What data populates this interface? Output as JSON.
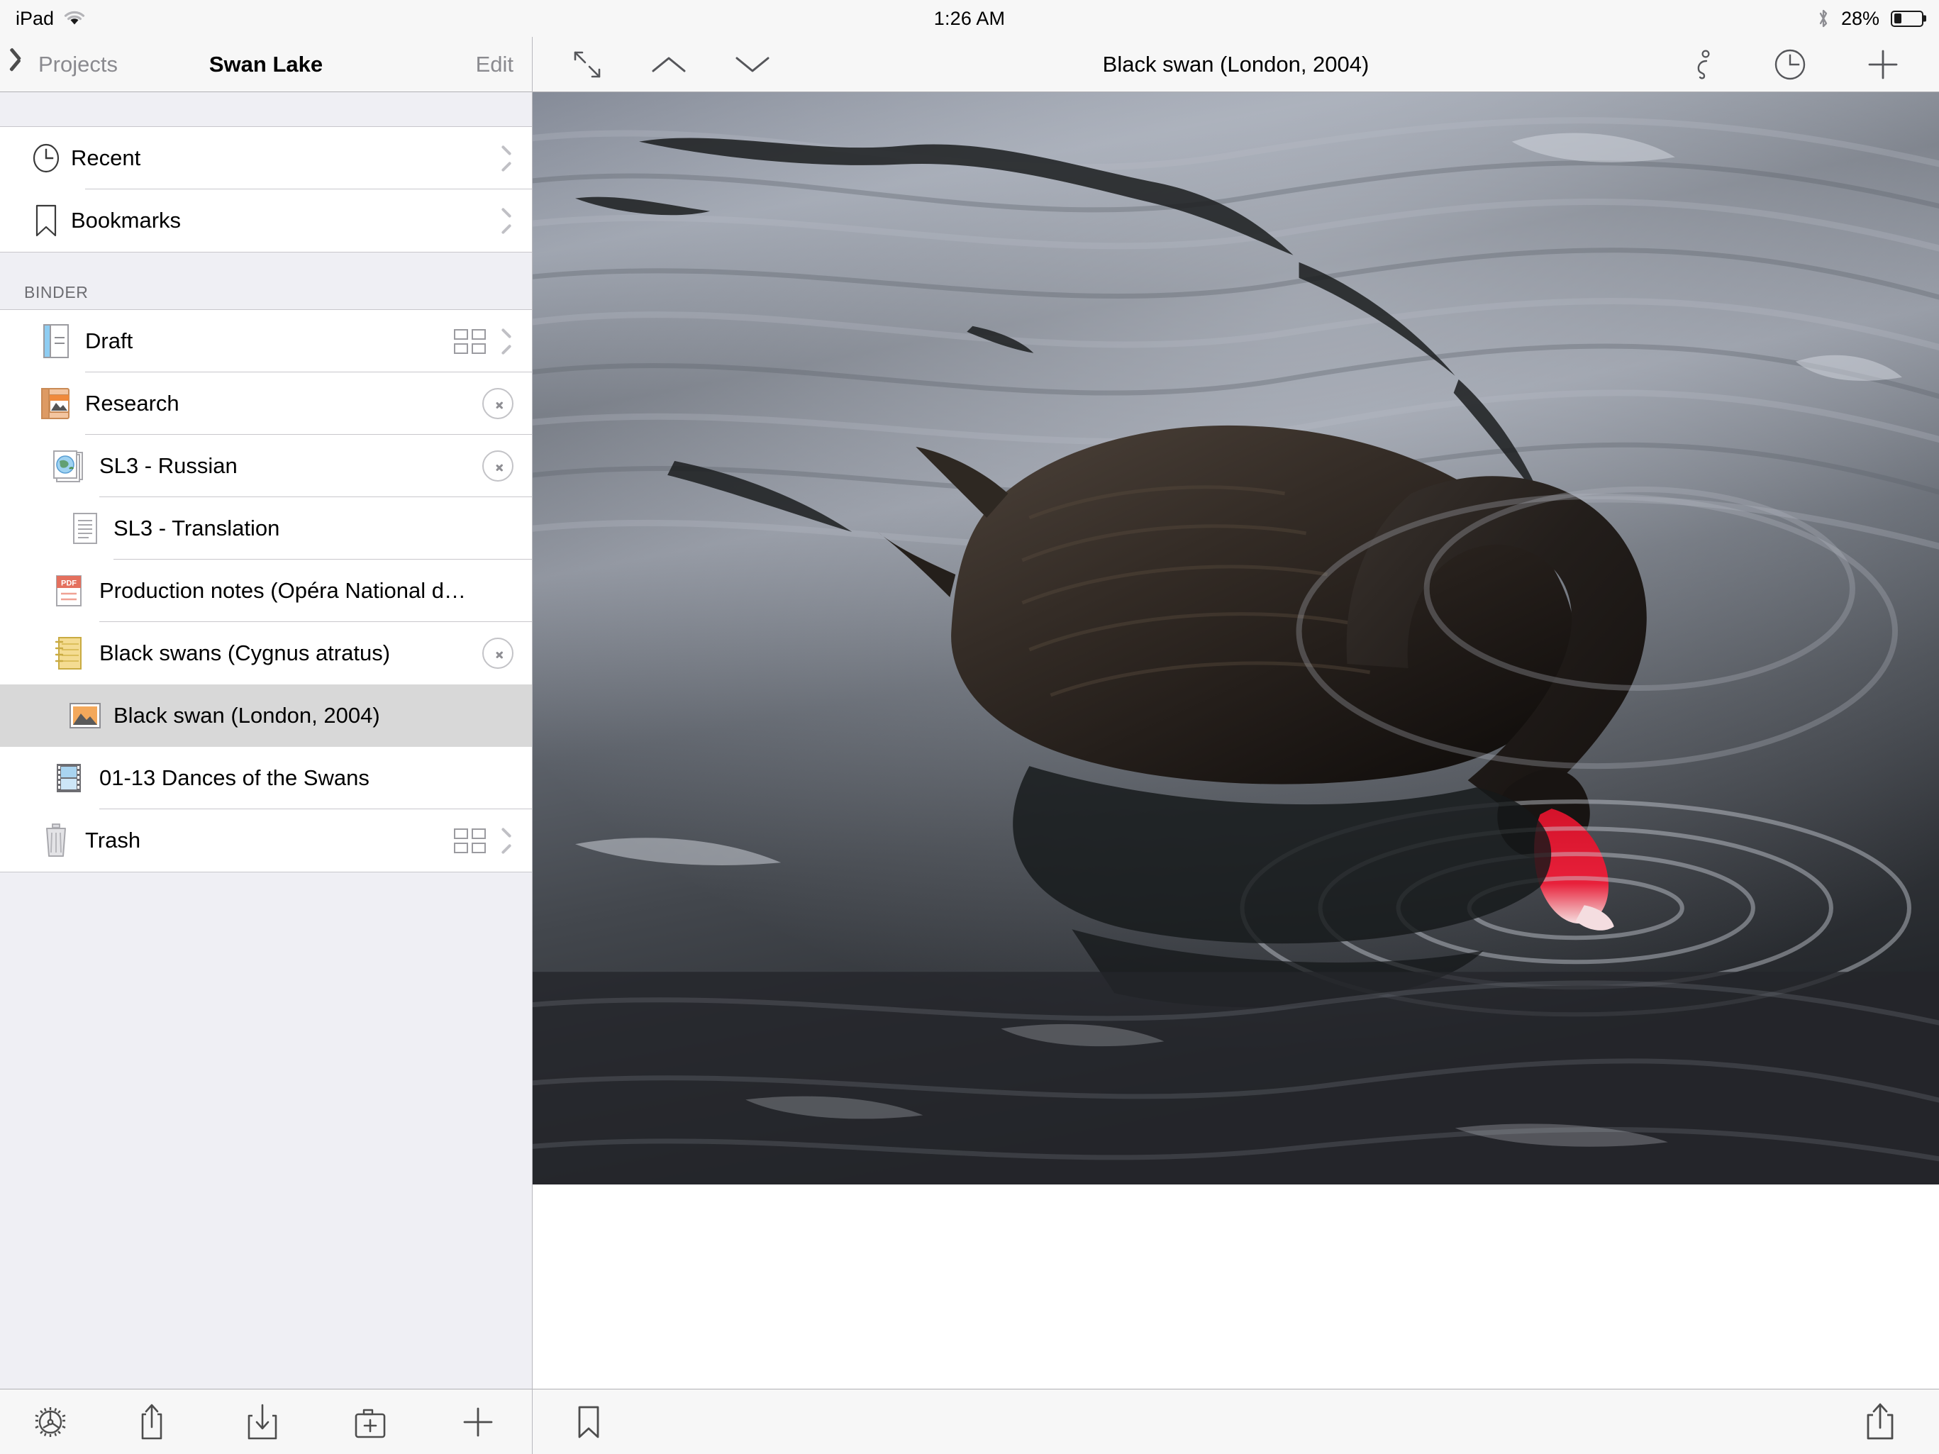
{
  "status_bar": {
    "device_label": "iPad",
    "wifi_icon": "wifi-icon",
    "time": "1:26 AM",
    "bluetooth_icon": "bluetooth-icon",
    "battery_percent": "28%",
    "battery_level": 28
  },
  "sidebar": {
    "nav": {
      "back_label": "Projects",
      "title": "Swan Lake",
      "edit_label": "Edit"
    },
    "quick_items": [
      {
        "label": "Recent",
        "icon": "clock-icon",
        "accessory": "chevron"
      },
      {
        "label": "Bookmarks",
        "icon": "bookmark-icon",
        "accessory": "chevron"
      }
    ],
    "section_header": "BINDER",
    "binder_items": [
      {
        "label": "Draft",
        "icon": "manuscript-icon",
        "indent": 0,
        "accessory": "corkboard-chevron",
        "selected": false
      },
      {
        "label": "Research",
        "icon": "research-folder-icon",
        "indent": 0,
        "accessory": "circle-chevron",
        "selected": false
      },
      {
        "label": "SL3 - Russian",
        "icon": "web-page-stack-icon",
        "indent": 1,
        "accessory": "circle-chevron",
        "selected": false
      },
      {
        "label": "SL3 - Translation",
        "icon": "text-document-icon",
        "indent": 2,
        "accessory": "none",
        "selected": false
      },
      {
        "label": "Production notes (Opéra National d…",
        "icon": "pdf-icon",
        "indent": 1,
        "accessory": "none",
        "selected": false
      },
      {
        "label": "Black swans (Cygnus atratus)",
        "icon": "notepad-icon",
        "indent": 1,
        "accessory": "circle-chevron",
        "selected": false
      },
      {
        "label": "Black swan (London, 2004)",
        "icon": "image-icon",
        "indent": 2,
        "accessory": "none",
        "selected": true
      },
      {
        "label": "01-13 Dances of the Swans",
        "icon": "filmstrip-icon",
        "indent": 1,
        "accessory": "none",
        "selected": false
      },
      {
        "label": "Trash",
        "icon": "trash-icon",
        "indent": 0,
        "accessory": "corkboard-chevron",
        "selected": false
      }
    ],
    "toolbar": [
      {
        "name": "settings-button",
        "icon": "gear-icon"
      },
      {
        "name": "export-button",
        "icon": "share-icon"
      },
      {
        "name": "import-button",
        "icon": "import-icon"
      },
      {
        "name": "new-folder-button",
        "icon": "new-folder-icon"
      },
      {
        "name": "add-button",
        "icon": "plus-icon"
      }
    ]
  },
  "detail": {
    "nav": {
      "expand_icon": "expand-arrows-icon",
      "previous_icon": "chevron-up-icon",
      "next_icon": "chevron-down-icon",
      "title": "Black swan (London, 2004)",
      "info_icon": "info-italic-icon",
      "history_icon": "clock-history-icon",
      "add_icon": "plus-icon"
    },
    "content": {
      "media_type": "photograph",
      "subject": "Black swan on rippled water, bill dipped into the surface",
      "alt": "Black swan (London, 2004)"
    },
    "toolbar": {
      "bookmark_icon": "bookmark-icon",
      "share_icon": "share-icon"
    }
  },
  "colors": {
    "chrome": "#f7f7f7",
    "group_background": "#efeff4",
    "row_background": "#ffffff",
    "selected_row": "#d8d8d8",
    "separator": "#c8c7cc",
    "secondary_text": "#8a8a8f",
    "icon_stroke": "#4d4d4d",
    "pdf_red": "#e4705e",
    "notepad_yellow": "#f2d98a",
    "research_orange": "#e08a4e",
    "film_blue": "#a9d4f0",
    "swan_bill_red": "#e31c2b"
  }
}
